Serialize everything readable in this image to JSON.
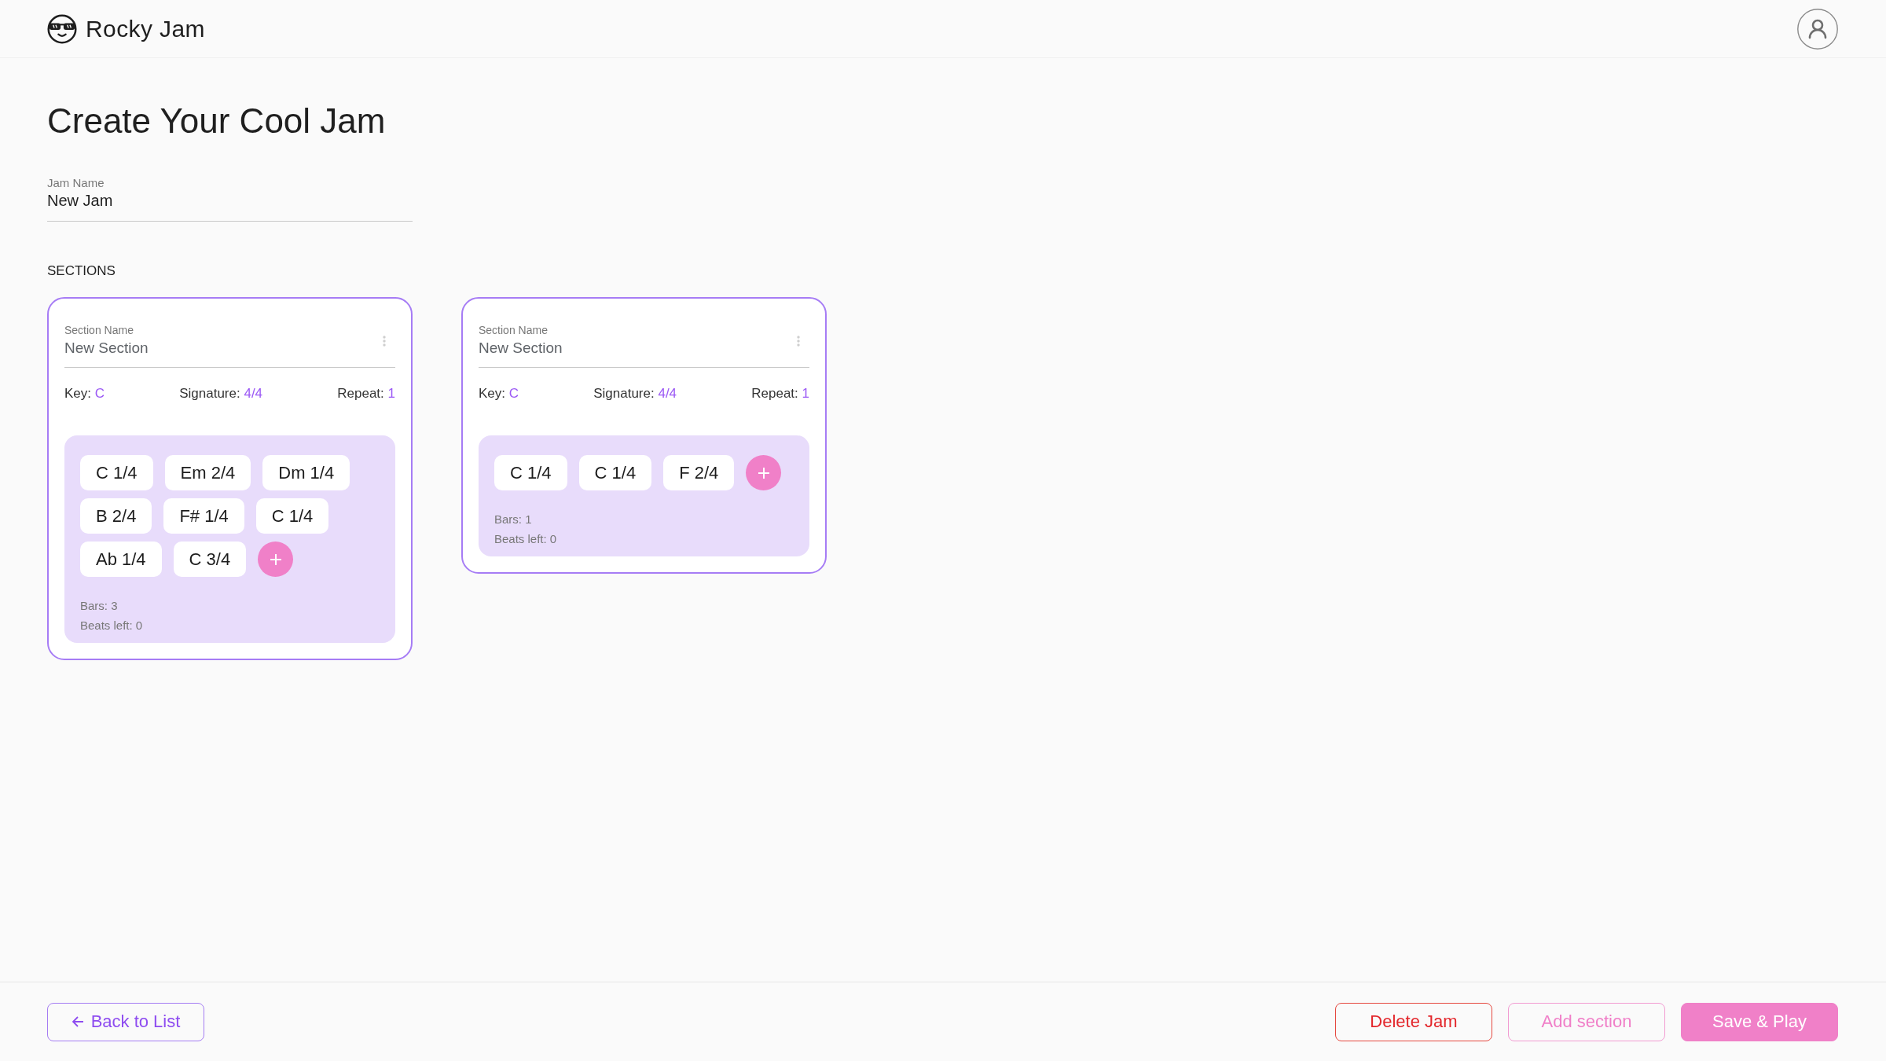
{
  "header": {
    "logo_text": "Rocky Jam"
  },
  "title": "Create Your Cool Jam",
  "jam_name": {
    "label": "Jam Name",
    "value": "New Jam"
  },
  "sections_heading": "SECTIONS",
  "sections": [
    {
      "name_field": {
        "label": "Section Name",
        "value": "New Section"
      },
      "settings": [
        {
          "label": "Key:",
          "value": "C"
        },
        {
          "label": "Signature:",
          "value": "4/4"
        },
        {
          "label": "Repeat:",
          "value": "1"
        }
      ],
      "chords": [
        "C 1/4",
        "Em 2/4",
        "Dm 1/4",
        "B 2/4",
        "F# 1/4",
        "C 1/4",
        "Ab 1/4",
        "C 3/4"
      ],
      "bars": "Bars: 3",
      "beats_left": "Beats left: 0"
    },
    {
      "name_field": {
        "label": "Section Name",
        "value": "New Section"
      },
      "settings": [
        {
          "label": "Key:",
          "value": "C"
        },
        {
          "label": "Signature:",
          "value": "4/4"
        },
        {
          "label": "Repeat:",
          "value": "1"
        }
      ],
      "chords": [
        "C 1/4",
        "C 1/4",
        "F 2/4"
      ],
      "bars": "Bars: 1",
      "beats_left": "Beats left: 0"
    }
  ],
  "footer": {
    "buttons": [
      {
        "label": "Back to List",
        "kind": "back"
      },
      {
        "label": "Delete Jam",
        "kind": "danger"
      },
      {
        "label": "Add section",
        "kind": "outlined"
      },
      {
        "label": "Save & Play",
        "kind": "primary"
      }
    ]
  }
}
